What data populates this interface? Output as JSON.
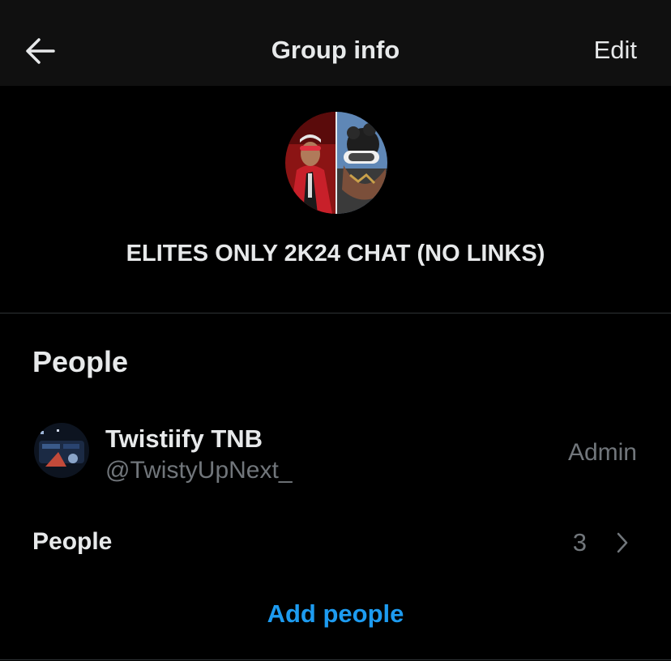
{
  "header": {
    "title": "Group info",
    "edit_label": "Edit",
    "back_icon": "arrow-left-icon"
  },
  "group": {
    "name": "ELITES ONLY 2K24 CHAT (NO LINKS)"
  },
  "people_section": {
    "heading": "People",
    "members": [
      {
        "display_name": "Twistiify TNB",
        "handle": "@TwistyUpNext_",
        "role": "Admin"
      }
    ],
    "summary_label": "People",
    "count": "3",
    "chevron_icon": "chevron-right-icon",
    "add_label": "Add people"
  },
  "colors": {
    "background": "#000000",
    "header_background": "#101010",
    "primary_text": "#e7e9ea",
    "secondary_text": "#71767b",
    "accent": "#1d9bf0",
    "divider": "#2f3336"
  }
}
